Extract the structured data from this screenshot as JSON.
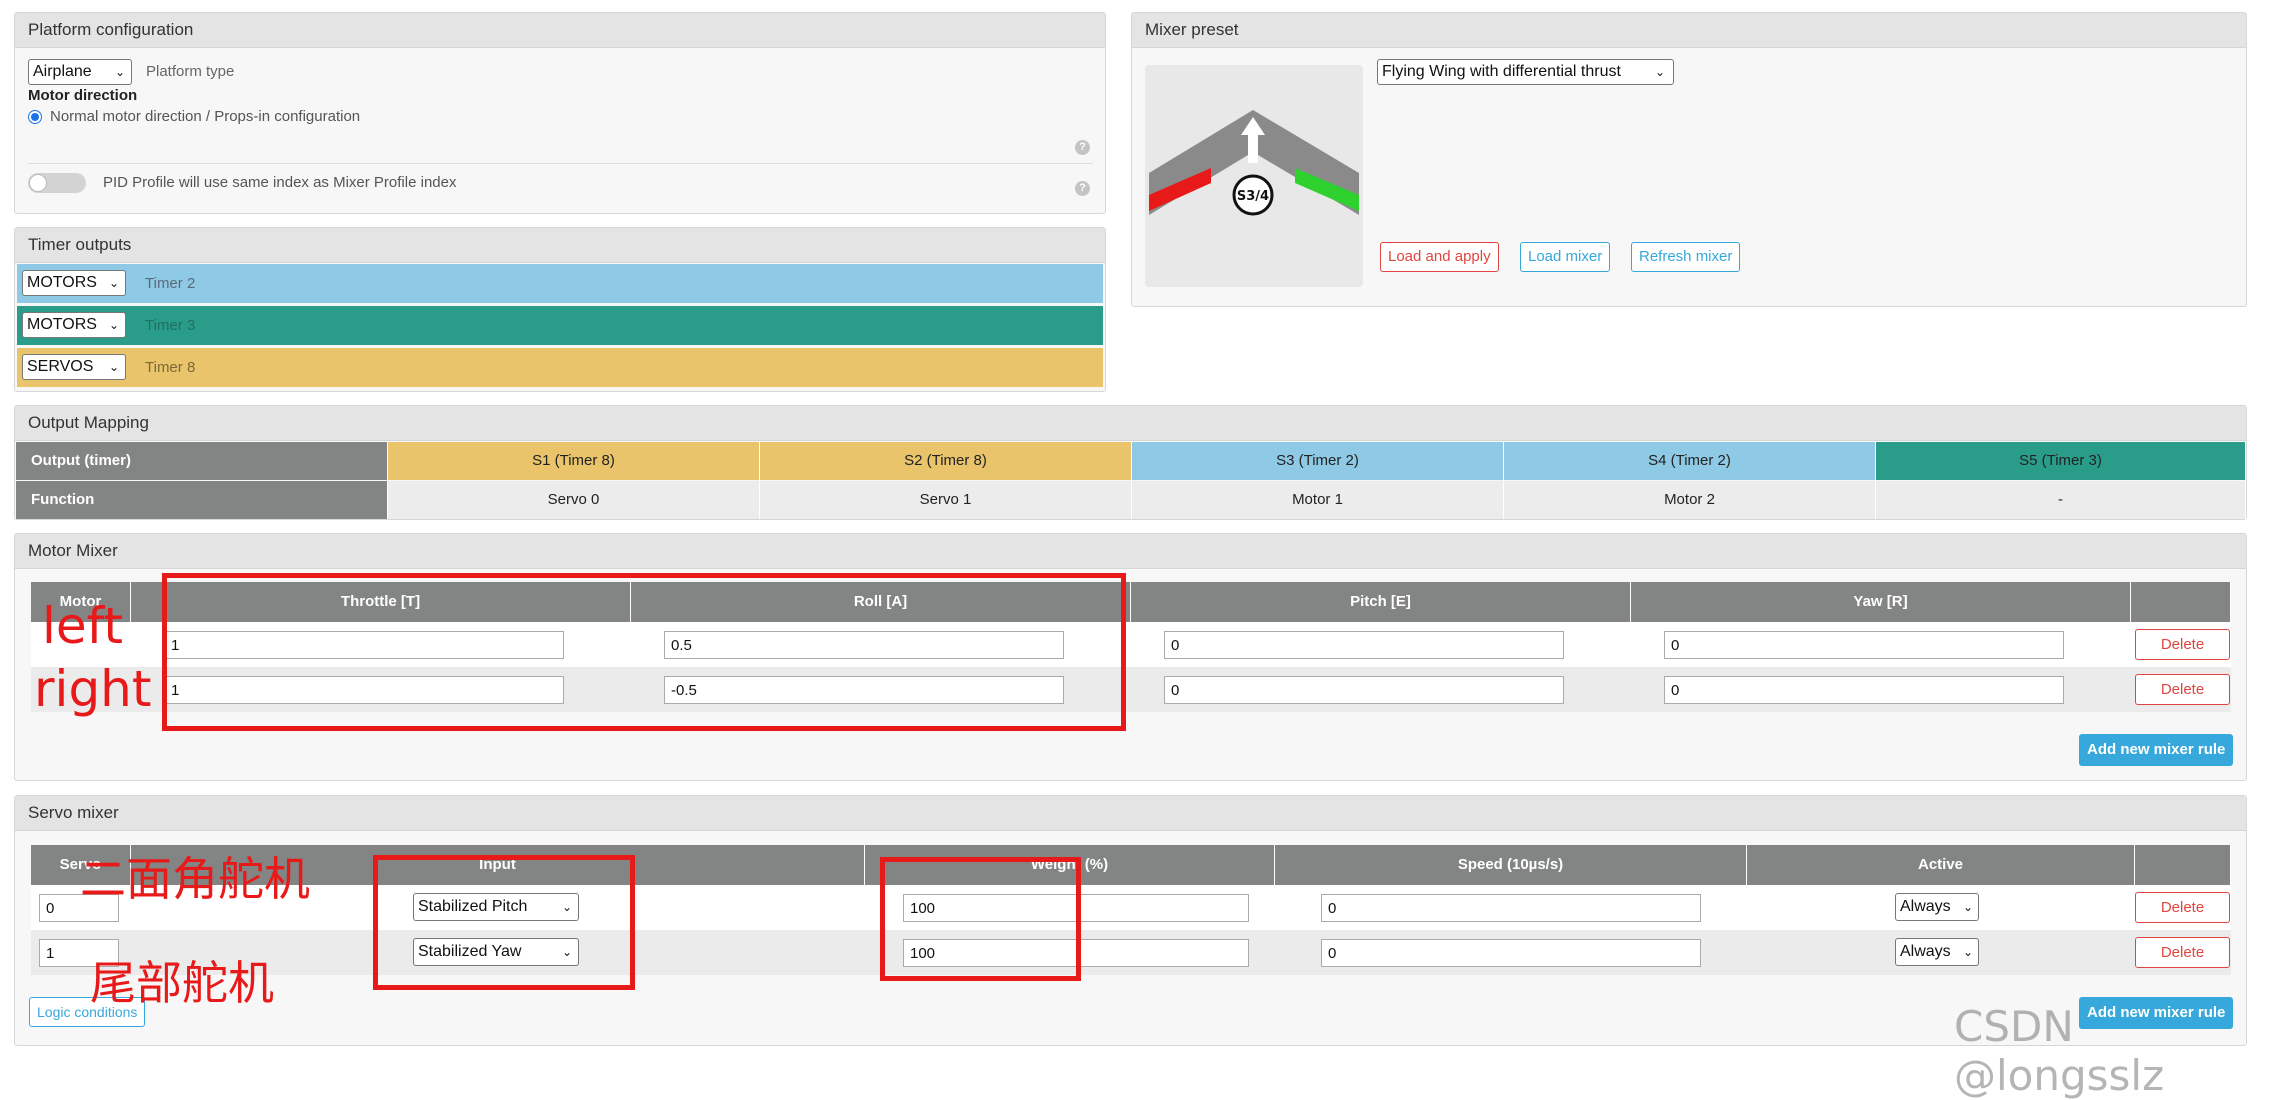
{
  "platform": {
    "title": "Platform configuration",
    "platform_type_value": "Airplane",
    "platform_type_label": "Platform type",
    "motor_direction_heading": "Motor direction",
    "motor_direction_option": "Normal motor direction / Props-in configuration",
    "pid_profile_label": "PID Profile will use same index as Mixer Profile index",
    "help_glyph": "?"
  },
  "timer_outputs": {
    "title": "Timer outputs",
    "rows": [
      {
        "mode": "MOTORS",
        "timer": "Timer 2",
        "color": "#8ecae6"
      },
      {
        "mode": "MOTORS",
        "timer": "Timer 3",
        "color": "#2a9d8a"
      },
      {
        "mode": "SERVOS",
        "timer": "Timer 8",
        "color": "#e9c46a"
      }
    ]
  },
  "mixer_preset": {
    "title": "Mixer preset",
    "preset_value": "Flying Wing with differential thrust",
    "image_label": "S3/4",
    "load_apply": "Load and apply",
    "load_mixer": "Load mixer",
    "refresh_mixer": "Refresh mixer"
  },
  "output_mapping": {
    "title": "Output Mapping",
    "row1_label": "Output (timer)",
    "row2_label": "Function",
    "columns": [
      {
        "output": "S1 (Timer 8)",
        "function": "Servo 0",
        "color": "#e9c46a"
      },
      {
        "output": "S2 (Timer 8)",
        "function": "Servo 1",
        "color": "#e9c46a"
      },
      {
        "output": "S3 (Timer 2)",
        "function": "Motor 1",
        "color": "#8ecae6"
      },
      {
        "output": "S4 (Timer 2)",
        "function": "Motor 2",
        "color": "#8ecae6"
      },
      {
        "output": "S5 (Timer 3)",
        "function": "-",
        "color": "#2a9d8a"
      }
    ]
  },
  "motor_mixer": {
    "title": "Motor Mixer",
    "headers": [
      "Motor",
      "Throttle [T]",
      "Roll [A]",
      "Pitch [E]",
      "Yaw [R]"
    ],
    "rows": [
      {
        "throttle": "1",
        "roll": "0.5",
        "pitch": "0",
        "yaw": "0"
      },
      {
        "throttle": "1",
        "roll": "-0.5",
        "pitch": "0",
        "yaw": "0"
      }
    ],
    "delete_label": "Delete",
    "add_rule": "Add new mixer rule"
  },
  "servo_mixer": {
    "title": "Servo mixer",
    "headers": [
      "Servo",
      "Input",
      "Weight (%)",
      "Speed (10µs/s)",
      "Active"
    ],
    "rows": [
      {
        "servo": "0",
        "input": "Stabilized Pitch",
        "weight": "100",
        "speed": "0",
        "active": "Always"
      },
      {
        "servo": "1",
        "input": "Stabilized Yaw",
        "weight": "100",
        "speed": "0",
        "active": "Always"
      }
    ],
    "delete_label": "Delete",
    "add_rule": "Add new mixer rule",
    "logic_conditions": "Logic conditions"
  },
  "annotations": {
    "left": "left",
    "right": "right",
    "servo1": "二面角舵机",
    "servo2": "尾部舵机",
    "annotation_color": "#e81919"
  },
  "watermark": "CSDN @longsslz"
}
